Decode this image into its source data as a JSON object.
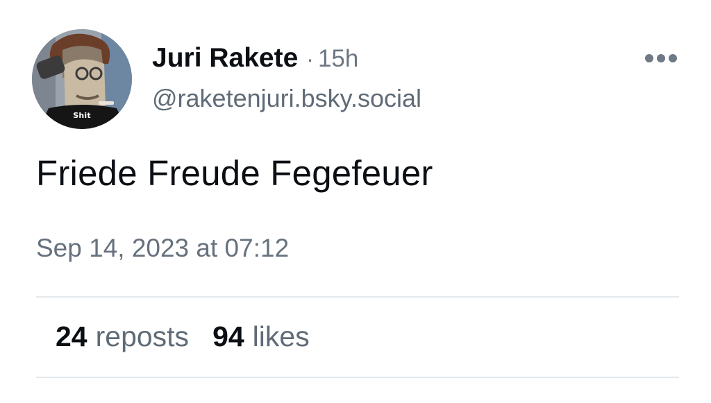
{
  "post": {
    "author": {
      "display_name": "Juri Rakete",
      "handle": "@raketenjuri.bsky.social",
      "avatar_caption": "Shit"
    },
    "separator": "·",
    "age": "15h",
    "text": "Friede Freude Fegefeuer",
    "timestamp": "Sep 14, 2023 at 07:12",
    "stats": {
      "reposts_count": "24",
      "reposts_label": "reposts",
      "likes_count": "94",
      "likes_label": "likes"
    },
    "menu_icon": "more-horizontal-icon"
  },
  "colors": {
    "text_primary": "#0b0f14",
    "text_secondary": "#5f6b77",
    "divider": "#e4e8ec",
    "background": "#ffffff"
  }
}
